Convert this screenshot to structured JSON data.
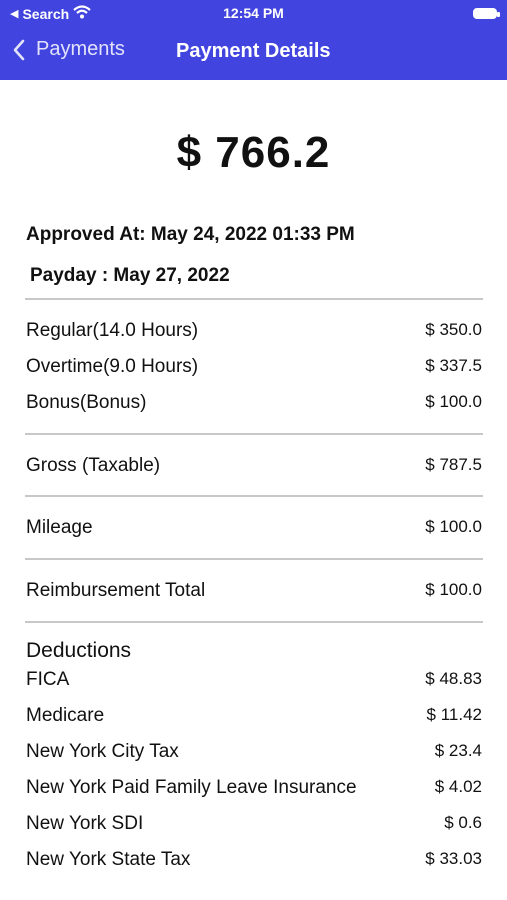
{
  "status_bar": {
    "back_app": "Search",
    "time": "12:54 PM"
  },
  "nav": {
    "back_label": "Payments",
    "title": "Payment Details"
  },
  "amount": "$ 766.2",
  "approved": "Approved At: May 24, 2022 01:33 PM",
  "payday": "Payday : May 27, 2022",
  "earnings": [
    {
      "label": "Regular(14.0 Hours)",
      "value": "$ 350.0"
    },
    {
      "label": "Overtime(9.0 Hours)",
      "value": "$ 337.5"
    },
    {
      "label": "Bonus(Bonus)",
      "value": "$ 100.0"
    }
  ],
  "gross": {
    "label": "Gross (Taxable)",
    "value": "$ 787.5"
  },
  "mileage": {
    "label": "Mileage",
    "value": "$ 100.0"
  },
  "reimbursement": {
    "label": "Reimbursement Total",
    "value": "$ 100.0"
  },
  "deductions": {
    "title": "Deductions",
    "items": [
      {
        "label": "FICA",
        "value": "$ 48.83"
      },
      {
        "label": "Medicare",
        "value": "$ 11.42"
      },
      {
        "label": "New York City Tax",
        "value": "$ 23.4"
      },
      {
        "label": "New York Paid Family Leave Insurance",
        "value": "$ 4.02"
      },
      {
        "label": "New York SDI",
        "value": "$ 0.6"
      },
      {
        "label": "New York State Tax",
        "value": "$ 33.03"
      }
    ]
  },
  "colors": {
    "header": "#4244e0",
    "divider": "#c8c8c8"
  }
}
